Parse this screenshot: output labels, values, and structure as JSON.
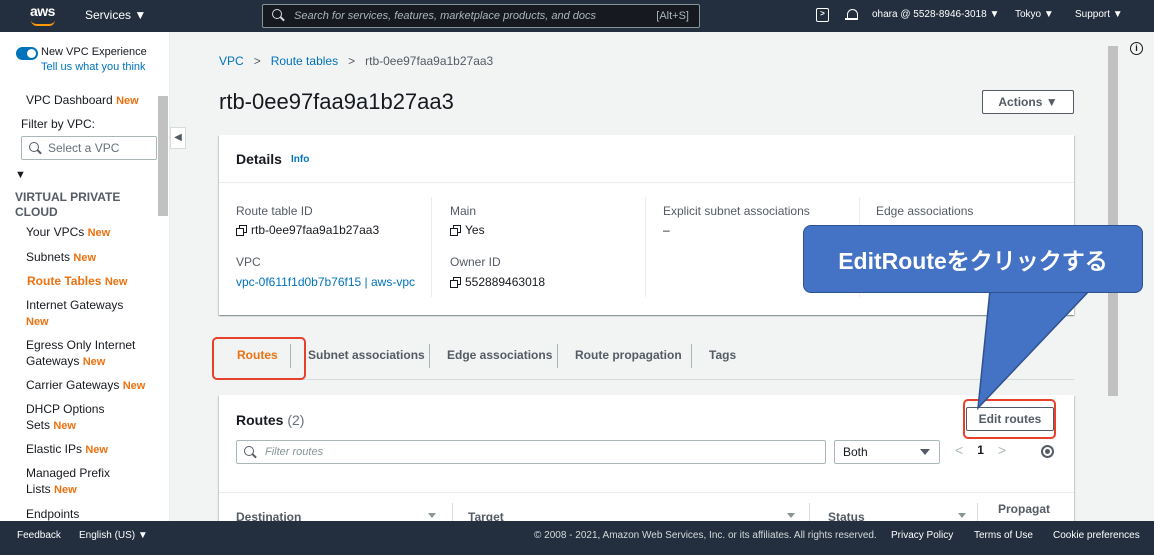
{
  "topnav": {
    "logo": "aws",
    "services": "Services ▼",
    "search_placeholder": "Search for services, features, marketplace products, and docs",
    "search_shortcut": "[Alt+S]",
    "account": "ohara @ 5528-8946-3018 ▼",
    "region": "Tokyo ▼",
    "support": "Support ▼"
  },
  "sidebar": {
    "new_experience": "New VPC Experience",
    "feedback_link": "Tell us what you think",
    "dashboard": "VPC Dashboard",
    "filter_label": "Filter by VPC:",
    "filter_placeholder": "Select a VPC",
    "section_caret": "▼",
    "section": "VIRTUAL PRIVATE CLOUD",
    "new_badge": "New",
    "items": [
      {
        "label": "Your VPCs"
      },
      {
        "label": "Subnets"
      },
      {
        "label": "Route Tables"
      },
      {
        "label": "Internet Gateways"
      },
      {
        "label": "Egress Only Internet Gateways"
      },
      {
        "label": "Carrier Gateways"
      },
      {
        "label": "DHCP Options Sets"
      },
      {
        "label": "Elastic IPs"
      },
      {
        "label": "Managed Prefix Lists"
      },
      {
        "label": "Endpoints"
      }
    ],
    "collapse_icon": "◀"
  },
  "breadcrumb": {
    "vpc": "VPC",
    "route_tables": "Route tables",
    "current": "rtb-0ee97faa9a1b27aa3",
    "sep": ">"
  },
  "page": {
    "title": "rtb-0ee97faa9a1b27aa3",
    "actions": "Actions ▼",
    "info_icon": "i"
  },
  "details": {
    "title": "Details",
    "info": "Info",
    "route_table_id_label": "Route table ID",
    "route_table_id": "rtb-0ee97faa9a1b27aa3",
    "main_label": "Main",
    "main": "Yes",
    "explicit_label": "Explicit subnet associations",
    "explicit": "–",
    "edge_label": "Edge associations",
    "vpc_label": "VPC",
    "vpc": "vpc-0f611f1d0b7b76f15 | aws-vpc",
    "owner_label": "Owner ID",
    "owner": "552889463018"
  },
  "tabs": [
    "Routes",
    "Subnet associations",
    "Edge associations",
    "Route propagation",
    "Tags"
  ],
  "routes": {
    "title": "Routes",
    "count": "(2)",
    "edit_button": "Edit routes",
    "filter_placeholder": "Filter routes",
    "select_value": "Both",
    "page": "1",
    "prev": "<",
    "next": ">",
    "columns": [
      "Destination",
      "Target",
      "Status",
      "Propagat"
    ]
  },
  "footer": {
    "feedback": "Feedback",
    "language": "English (US) ▼",
    "copyright": "© 2008 - 2021, Amazon Web Services, Inc. or its affiliates. All rights reserved.",
    "privacy": "Privacy Policy",
    "terms": "Terms of Use",
    "cookies": "Cookie preferences"
  },
  "annotation": {
    "callout_text": "EditRouteをクリックする",
    "highlight_color": "#e8412b",
    "callout_color": "#4472c4"
  }
}
